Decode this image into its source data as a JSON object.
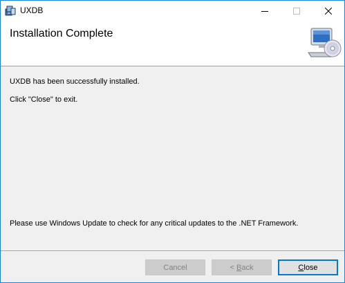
{
  "window": {
    "title": "UXDB",
    "controls": {
      "minimize_icon": "minimize-icon",
      "maximize_icon": "maximize-icon",
      "close_icon": "close-icon"
    }
  },
  "banner": {
    "title": "Installation Complete",
    "icon": "computer-cd-icon"
  },
  "content": {
    "line1": "UXDB has been successfully installed.",
    "line2": "Click \"Close\" to exit.",
    "line3": "Please use Windows Update to check for any critical updates to the .NET Framework."
  },
  "buttons": {
    "cancel": "Cancel",
    "back_prefix": "< ",
    "back_mnemonic": "B",
    "back_rest": "ack",
    "close_mnemonic": "C",
    "close_rest": "lose"
  },
  "colors": {
    "accent": "#0078d7",
    "window_border": "#1883d7",
    "background": "#f0f0f0"
  }
}
